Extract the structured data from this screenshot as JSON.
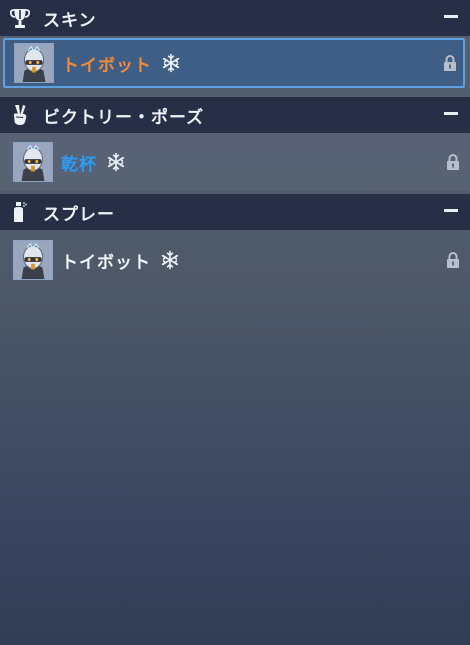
{
  "sections": [
    {
      "title": "スキン",
      "icon": "trophy-icon",
      "items": [
        {
          "name": "トイボット",
          "name_color": "#f08a3c",
          "selected": true,
          "locked": true,
          "event_icon": "snowflake-icon"
        }
      ]
    },
    {
      "title": "ビクトリー・ポーズ",
      "icon": "victory-hand-icon",
      "items": [
        {
          "name": "乾杯",
          "name_color": "#2b9bf4",
          "selected": false,
          "locked": true,
          "event_icon": "snowflake-icon"
        }
      ]
    },
    {
      "title": "スプレー",
      "icon": "spray-can-icon",
      "items": [
        {
          "name": "トイボット",
          "name_color": "#f2f4f8",
          "selected": false,
          "locked": true,
          "event_icon": "snowflake-icon"
        }
      ]
    }
  ],
  "colors": {
    "header_bg": "#262f45",
    "selected_bg": "#3f5e86",
    "selected_border": "#5ea0e0"
  }
}
